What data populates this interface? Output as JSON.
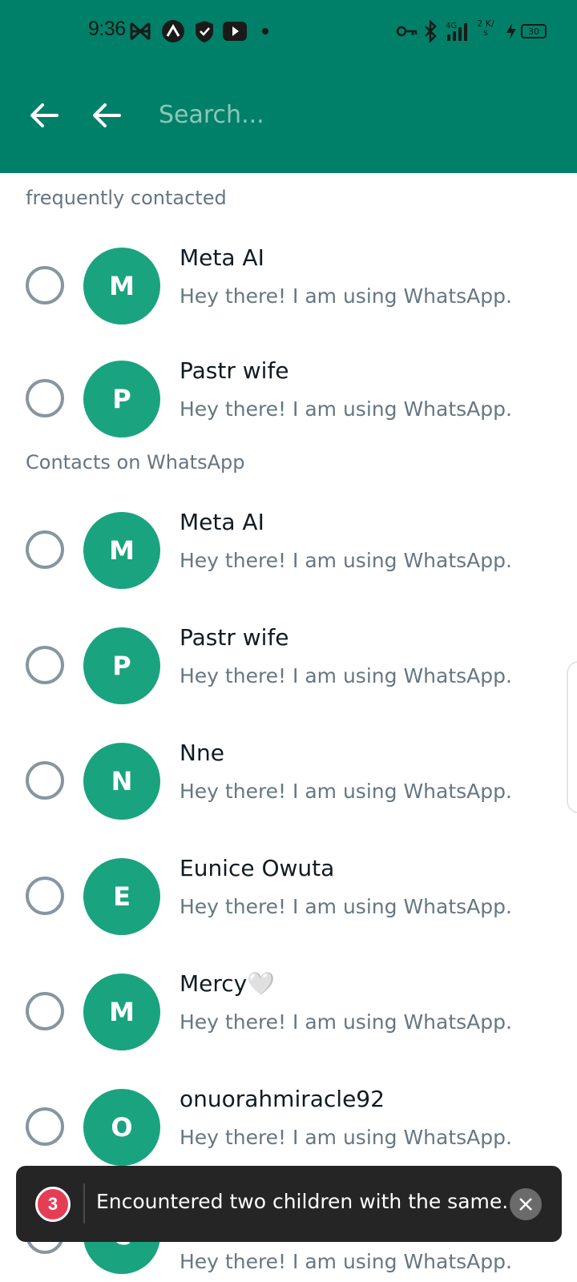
{
  "status_bar": {
    "time": "9:36",
    "network": "4G",
    "speed": "2 K/s",
    "battery": "30"
  },
  "toolbar": {
    "search_placeholder": "Search..."
  },
  "sections": [
    {
      "title": "frequently contacted",
      "contacts": [
        {
          "initial": "M",
          "name": "Meta AI",
          "about": "Hey there! I am using WhatsApp."
        },
        {
          "initial": "P",
          "name": "Pastr wife",
          "about": "Hey there! I am using WhatsApp."
        }
      ]
    },
    {
      "title": "Contacts on WhatsApp",
      "contacts": [
        {
          "initial": "M",
          "name": "Meta AI",
          "about": "Hey there! I am using WhatsApp."
        },
        {
          "initial": "P",
          "name": "Pastr wife",
          "about": "Hey there! I am using WhatsApp."
        },
        {
          "initial": "N",
          "name": "Nne",
          "about": "Hey there! I am using WhatsApp."
        },
        {
          "initial": "E",
          "name": "Eunice Owuta",
          "about": "Hey there! I am using WhatsApp."
        },
        {
          "initial": "M",
          "name": "Mercy🤍",
          "about": "Hey there! I am using WhatsApp."
        },
        {
          "initial": "O",
          "name": "onuorahmiracle92",
          "about": "Hey there! I am using WhatsApp."
        },
        {
          "initial": "C",
          "name": "",
          "about": "Hey there! I am using WhatsApp."
        }
      ]
    }
  ],
  "toast": {
    "count": "3",
    "message": "Encountered two children with the same..."
  },
  "colors": {
    "header": "#008069",
    "avatar": "#1aa37f",
    "toast_bg": "#252526",
    "badge": "#e63d56"
  }
}
